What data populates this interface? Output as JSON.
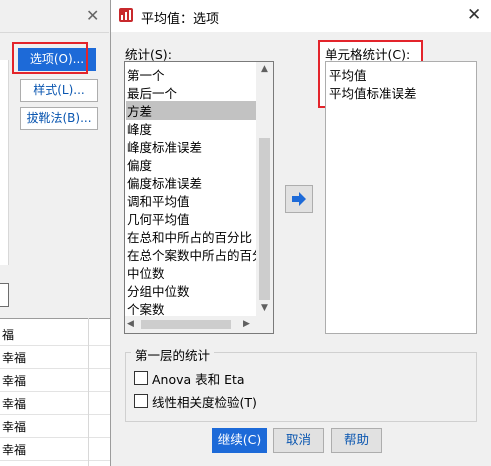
{
  "background_dialog": {
    "buttons": [
      "选项(O)...",
      "样式(L)...",
      "拔靴法(B)..."
    ]
  },
  "background_grid": {
    "rows": [
      "福",
      "幸福",
      "幸福",
      "幸福",
      "幸福",
      "幸福",
      "幸福"
    ]
  },
  "dialog": {
    "title": "平均值：选项",
    "stats_label": "统计(S):",
    "stats_items": [
      "第一个",
      "最后一个",
      "方差",
      "峰度",
      "峰度标准误差",
      "偏度",
      "偏度标准误差",
      "调和平均值",
      "几何平均值",
      "在总和中所占的百分比",
      "在总个案数中所占的百分比",
      "中位数",
      "分组中位数",
      "个案数"
    ],
    "selected_index": 2,
    "cell_label": "单元格统计(C):",
    "cell_items": [
      "平均值",
      "平均值标准误差"
    ],
    "group_label": "第一层的统计",
    "check_anova": "Anova 表和 Eta",
    "check_linear": "线性相关度检验(T)",
    "btn_continue": "继续(C)",
    "btn_cancel": "取消",
    "btn_help": "帮助"
  },
  "colors": {
    "accent": "#1d6ad8",
    "highlight": "#e3242b"
  }
}
